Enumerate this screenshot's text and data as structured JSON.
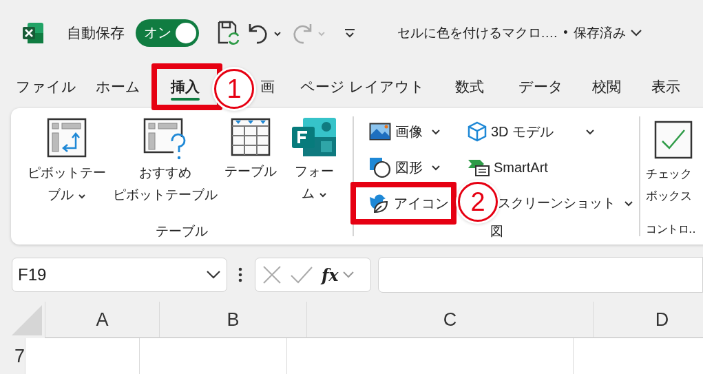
{
  "app_bar": {
    "autosave_label": "自動保存",
    "autosave_toggle": {
      "label": "オン",
      "on": true
    },
    "document_title": "セルに色を付けるマクロ.…",
    "separator": "•",
    "save_status": "保存済み"
  },
  "tabs": [
    {
      "label": "ファイル",
      "selected": false
    },
    {
      "label": "ホーム",
      "selected": false
    },
    {
      "label": "挿入",
      "selected": true
    },
    {
      "label": "画",
      "selected": false
    },
    {
      "label": "ページ レイアウト",
      "selected": false
    },
    {
      "label": "数式",
      "selected": false
    },
    {
      "label": "データ",
      "selected": false
    },
    {
      "label": "校閲",
      "selected": false
    },
    {
      "label": "表示",
      "selected": false
    }
  ],
  "ribbon": {
    "groups": [
      {
        "label": "テーブル",
        "kind": "large",
        "buttons": [
          {
            "kind": "pivot",
            "lines": [
              "ピボットテー",
              "ブル"
            ],
            "dropdown": true
          },
          {
            "kind": "recommended",
            "lines": [
              "おすすめ",
              "ピボットテーブル"
            ],
            "dropdown": false
          },
          {
            "kind": "table",
            "lines": [
              "テーブル"
            ],
            "dropdown": false
          },
          {
            "kind": "form",
            "lines": [
              "フォー",
              "ム"
            ],
            "dropdown": true
          }
        ]
      },
      {
        "label": "図",
        "kind": "small",
        "buttons": [
          {
            "kind": "image",
            "label": "画像",
            "dropdown": true
          },
          {
            "kind": "model3d",
            "label": "3D モデル",
            "dropdown": true
          },
          {
            "kind": "shapes",
            "label": "図形",
            "dropdown": true
          },
          {
            "kind": "smartart",
            "label": "SmartArt",
            "dropdown": false
          },
          {
            "kind": "icons",
            "label": "アイコン",
            "dropdown": false
          },
          {
            "kind": "screenshot",
            "label": "スクリーンショット",
            "dropdown": true
          }
        ]
      },
      {
        "label": "コントロ‥",
        "kind": "large",
        "buttons": [
          {
            "kind": "checkbox",
            "lines": [
              "チェック",
              "ボックス"
            ],
            "dropdown": false
          }
        ]
      }
    ]
  },
  "callouts": [
    {
      "number": "1"
    },
    {
      "number": "2"
    }
  ],
  "formula_bar": {
    "name_box": "F19",
    "insert_function": "fx"
  },
  "grid": {
    "columns": [
      "A",
      "B",
      "C",
      "D"
    ],
    "rows": [
      "7"
    ]
  }
}
